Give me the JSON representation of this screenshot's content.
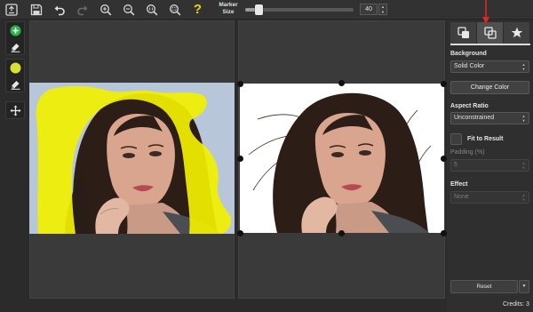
{
  "toolbar": {
    "marker_size_label": "Marker Size",
    "marker_size_value": "40",
    "marker_size_fraction": 0.1,
    "buttons": [
      "open-icon",
      "save-icon",
      "undo-icon",
      "redo-icon",
      "zoom-in-icon",
      "zoom-out-icon",
      "actual-size-icon",
      "zoom-fit-icon",
      "help-icon"
    ],
    "help_label": "?"
  },
  "left_tools": [
    "add-keep-marker-icon",
    "eraser-icon",
    "remove-marker-icon",
    "eraser-icon",
    "move-icon"
  ],
  "sidebar": {
    "tabs": [
      "background-tab",
      "output-tab",
      "effects-tab"
    ],
    "background": {
      "label": "Background",
      "value": "Solid Color",
      "button": "Change Color"
    },
    "aspect_ratio": {
      "label": "Aspect Ratio",
      "value": "Unconstrained"
    },
    "fit_to_result": {
      "label": "Fit to Result"
    },
    "padding": {
      "label": "Padding (%)",
      "value": "5"
    },
    "effect": {
      "label": "Effect",
      "value": "None"
    },
    "reset": "Reset"
  },
  "status": {
    "credits": "Credits: 3"
  },
  "colors": {
    "marker_yellow": "#f2f000",
    "annotation_red": "#e0271f",
    "bg_dark": "#2b2b2b"
  }
}
